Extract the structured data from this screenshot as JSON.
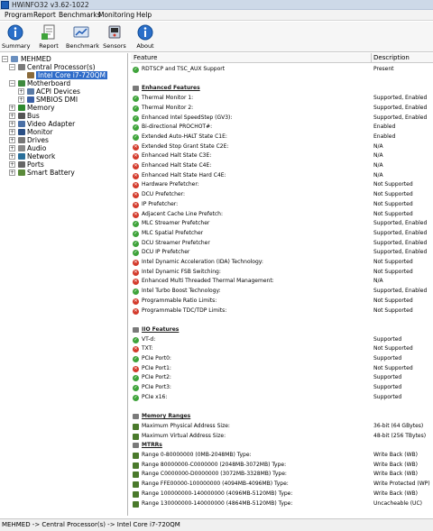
{
  "window": {
    "title": "HWiNFO32 v3.62-1022"
  },
  "menu": [
    "Program",
    "Report",
    "Benchmarks",
    "Monitoring",
    "Help"
  ],
  "toolbar": [
    "Summary",
    "Report",
    "Benchmark",
    "Sensors",
    "About"
  ],
  "tree": {
    "root": "MEHMED",
    "items": [
      {
        "label": "Central Processor(s)",
        "icon": "cpu-icon",
        "expander": "-"
      },
      {
        "label": "Intel Core i7-720QM",
        "icon": "chip-icon",
        "expander": ""
      },
      {
        "label": "Motherboard",
        "icon": "motherboard-icon",
        "expander": "-"
      },
      {
        "label": "ACPI Devices",
        "icon": "acpi-icon",
        "expander": "+"
      },
      {
        "label": "SMBIOS DMI",
        "icon": "smbios-icon",
        "expander": "+"
      },
      {
        "label": "Memory",
        "icon": "memory-icon",
        "expander": "+"
      },
      {
        "label": "Bus",
        "icon": "bus-icon",
        "expander": "+"
      },
      {
        "label": "Video Adapter",
        "icon": "video-adapter-icon",
        "expander": "+"
      },
      {
        "label": "Monitor",
        "icon": "monitor-icon",
        "expander": "+"
      },
      {
        "label": "Drives",
        "icon": "drives-icon",
        "expander": "+"
      },
      {
        "label": "Audio",
        "icon": "audio-icon",
        "expander": "+"
      },
      {
        "label": "Network",
        "icon": "network-icon",
        "expander": "+"
      },
      {
        "label": "Ports",
        "icon": "ports-icon",
        "expander": "+"
      },
      {
        "label": "Smart Battery",
        "icon": "battery-icon",
        "expander": "+"
      }
    ]
  },
  "grid": {
    "headers": {
      "feature": "Feature",
      "description": "Description"
    },
    "rows": [
      {
        "kind": "item",
        "status": "ok",
        "feature": "RDTSCP and TSC_AUX Support",
        "description": "Present"
      },
      {
        "kind": "blank"
      },
      {
        "kind": "section",
        "feature": "Enhanced Features"
      },
      {
        "kind": "item",
        "status": "ok",
        "feature": "Thermal Monitor 1:",
        "description": "Supported, Enabled"
      },
      {
        "kind": "item",
        "status": "ok",
        "feature": "Thermal Monitor 2:",
        "description": "Supported, Enabled"
      },
      {
        "kind": "item",
        "status": "ok",
        "feature": "Enhanced Intel SpeedStep (GV3):",
        "description": "Supported, Enabled"
      },
      {
        "kind": "item",
        "status": "ok",
        "feature": "Bi-directional PROCHOT#:",
        "description": "Enabled"
      },
      {
        "kind": "item",
        "status": "ok",
        "feature": "Extended Auto-HALT State C1E:",
        "description": "Enabled"
      },
      {
        "kind": "item",
        "status": "no",
        "feature": "Extended Stop Grant State C2E:",
        "description": "N/A"
      },
      {
        "kind": "item",
        "status": "no",
        "feature": "Enhanced Halt State C3E:",
        "description": "N/A"
      },
      {
        "kind": "item",
        "status": "no",
        "feature": "Enhanced Halt State C4E:",
        "description": "N/A"
      },
      {
        "kind": "item",
        "status": "no",
        "feature": "Enhanced Halt State Hard C4E:",
        "description": "N/A"
      },
      {
        "kind": "item",
        "status": "no",
        "feature": "Hardware Prefetcher:",
        "description": "Not Supported"
      },
      {
        "kind": "item",
        "status": "no",
        "feature": "DCU Prefetcher:",
        "description": "Not Supported"
      },
      {
        "kind": "item",
        "status": "no",
        "feature": "IP Prefetcher:",
        "description": "Not Supported"
      },
      {
        "kind": "item",
        "status": "no",
        "feature": "Adjacent Cache Line Prefetch:",
        "description": "Not Supported"
      },
      {
        "kind": "item",
        "status": "ok",
        "feature": "MLC Streamer Prefetcher",
        "description": "Supported, Enabled"
      },
      {
        "kind": "item",
        "status": "ok",
        "feature": "MLC Spatial Prefetcher",
        "description": "Supported, Enabled"
      },
      {
        "kind": "item",
        "status": "ok",
        "feature": "DCU Streamer Prefetcher",
        "description": "Supported, Enabled"
      },
      {
        "kind": "item",
        "status": "ok",
        "feature": "DCU IP Prefetcher",
        "description": "Supported, Enabled"
      },
      {
        "kind": "item",
        "status": "no",
        "feature": "Intel Dynamic Acceleration (IDA) Technology:",
        "description": "Not Supported"
      },
      {
        "kind": "item",
        "status": "no",
        "feature": "Intel Dynamic FSB Switching:",
        "description": "Not Supported"
      },
      {
        "kind": "item",
        "status": "no",
        "feature": "Enhanced Multi Threaded Thermal Management:",
        "description": "N/A"
      },
      {
        "kind": "item",
        "status": "ok",
        "feature": "Intel Turbo Boost Technology:",
        "description": "Supported, Enabled"
      },
      {
        "kind": "item",
        "status": "no",
        "feature": "Programmable Ratio Limits:",
        "description": "Not Supported"
      },
      {
        "kind": "item",
        "status": "no",
        "feature": "Programmable TDC/TDP Limits:",
        "description": "Not Supported"
      },
      {
        "kind": "blank"
      },
      {
        "kind": "section",
        "feature": "IIO Features"
      },
      {
        "kind": "item",
        "status": "ok",
        "feature": "VT-d:",
        "description": "Supported"
      },
      {
        "kind": "item",
        "status": "no",
        "feature": "TXT:",
        "description": "Not Supported"
      },
      {
        "kind": "item",
        "status": "ok",
        "feature": "PCIe Port0:",
        "description": "Supported"
      },
      {
        "kind": "item",
        "status": "no",
        "feature": "PCIe Port1:",
        "description": "Not Supported"
      },
      {
        "kind": "item",
        "status": "ok",
        "feature": "PCIe Port2:",
        "description": "Supported"
      },
      {
        "kind": "item",
        "status": "ok",
        "feature": "PCIe Port3:",
        "description": "Supported"
      },
      {
        "kind": "item",
        "status": "ok",
        "feature": "PCIe x16:",
        "description": "Supported"
      },
      {
        "kind": "blank"
      },
      {
        "kind": "section",
        "feature": "Memory Ranges"
      },
      {
        "kind": "item",
        "status": "mem",
        "feature": "Maximum Physical Address Size:",
        "description": "36-bit (64 GBytes)"
      },
      {
        "kind": "item",
        "status": "mem",
        "feature": "Maximum Virtual Address Size:",
        "description": "48-bit (256 TBytes)"
      },
      {
        "kind": "section",
        "feature": "MTRRs"
      },
      {
        "kind": "item",
        "status": "mem",
        "feature": "Range 0-80000000 (0MB-2048MB) Type:",
        "description": "Write Back (WB)"
      },
      {
        "kind": "item",
        "status": "mem",
        "feature": "Range 80000000-C0000000 (2048MB-3072MB) Type:",
        "description": "Write Back (WB)"
      },
      {
        "kind": "item",
        "status": "mem",
        "feature": "Range C0000000-D0000000 (3072MB-3328MB) Type:",
        "description": "Write Back (WB)"
      },
      {
        "kind": "item",
        "status": "mem",
        "feature": "Range FFE00000-100000000 (4094MB-4096MB) Type:",
        "description": "Write Protected (WP)"
      },
      {
        "kind": "item",
        "status": "mem",
        "feature": "Range 100000000-140000000 (4096MB-5120MB) Type:",
        "description": "Write Back (WB)"
      },
      {
        "kind": "item",
        "status": "mem",
        "feature": "Range 130000000-140000000 (4864MB-5120MB) Type:",
        "description": "Uncacheable (UC)"
      }
    ]
  },
  "status": "MEHMED -> Central Processor(s) -> Intel Core i7-720QM"
}
